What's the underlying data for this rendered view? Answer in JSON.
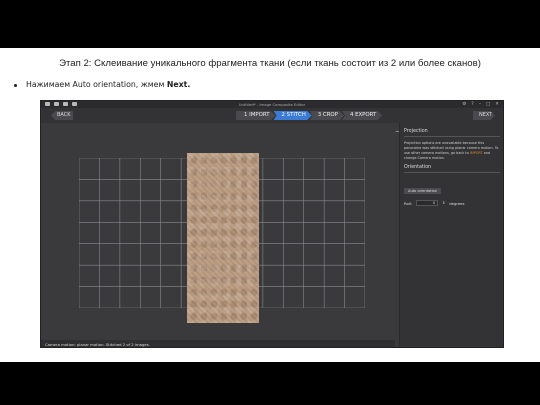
{
  "slide": {
    "title": "Этап 2: Склеивание уникального фрагмента ткани (если ткань состоит из 2 или более сканов)",
    "bullet_prefix": "Нажимаем Auto orientation, жмем ",
    "bullet_bold": "Next."
  },
  "app": {
    "title": "Untitled* - Image Composite Editor",
    "window_controls": [
      "⚙",
      "?",
      "–",
      "□",
      "✕"
    ],
    "nav": {
      "back_label": "BACK",
      "next_label": "NEXT",
      "steps": [
        {
          "label": "1 IMPORT",
          "active": false
        },
        {
          "label": "2 STITCH",
          "active": true
        },
        {
          "label": "3 CROP",
          "active": false
        },
        {
          "label": "4 EXPORT",
          "active": false
        }
      ]
    },
    "zoom": {
      "minus": "−",
      "plus": "+",
      "level": 0.7
    },
    "status_text": "Camera motion: planar motion. Stitched 2 of 2 images.",
    "panel": {
      "projection_heading": "Projection",
      "projection_text_1": "Projection options are unavailable because this panorama was stitched using planar camera motion. To use other camera motions, go back to ",
      "projection_link": "IMPORT",
      "projection_text_2": " and change Camera motion.",
      "orientation_heading": "Orientation",
      "auto_orientation_label": "Auto orientation",
      "roll_label": "Roll:",
      "roll_value": "0",
      "roll_unit": "degrees"
    },
    "colors": {
      "accent": "#3a7bd5",
      "background": "#3a3a3d",
      "link": "#d9892b",
      "fabric": "#b99b80"
    }
  }
}
